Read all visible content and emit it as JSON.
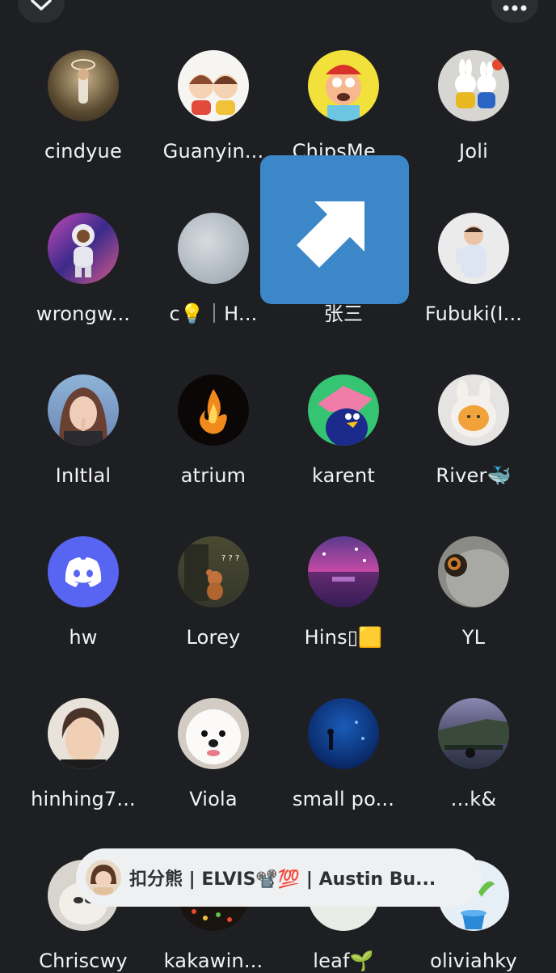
{
  "header": {
    "collapse_icon": "chevron-down-icon",
    "more_icon": "more-dots-icon"
  },
  "members": [
    {
      "name": "cindyue"
    },
    {
      "name": "Guanyin..."
    },
    {
      "name": "ChipsMe..."
    },
    {
      "name": "Joli"
    },
    {
      "name": "wrongw..."
    },
    {
      "name": "c💡｜H..."
    },
    {
      "name": "张三"
    },
    {
      "name": "Fubuki(I..."
    },
    {
      "name": "InItIal"
    },
    {
      "name": "atrium"
    },
    {
      "name": "karent"
    },
    {
      "name": "River🐳"
    },
    {
      "name": "hw"
    },
    {
      "name": "Lorey"
    },
    {
      "name": "Hins▯🟨"
    },
    {
      "name": "YL"
    },
    {
      "name": "hinhing7..."
    },
    {
      "name": "Viola"
    },
    {
      "name": "small po..."
    },
    {
      "name": "...k&"
    },
    {
      "name": "Chriscwy"
    },
    {
      "name": "kakawin..."
    },
    {
      "name": "leaf🌱"
    },
    {
      "name": "oliviahky"
    }
  ],
  "share_overlay": {
    "icon": "arrow-up-right-icon",
    "color": "#3b87c8"
  },
  "speaking_banner": {
    "text": "扣分熊 | ELVIS📽️💯 | Austin Bu..."
  },
  "theme": {
    "background": "#1e1f22",
    "discord_blurple": "#5865f2"
  }
}
